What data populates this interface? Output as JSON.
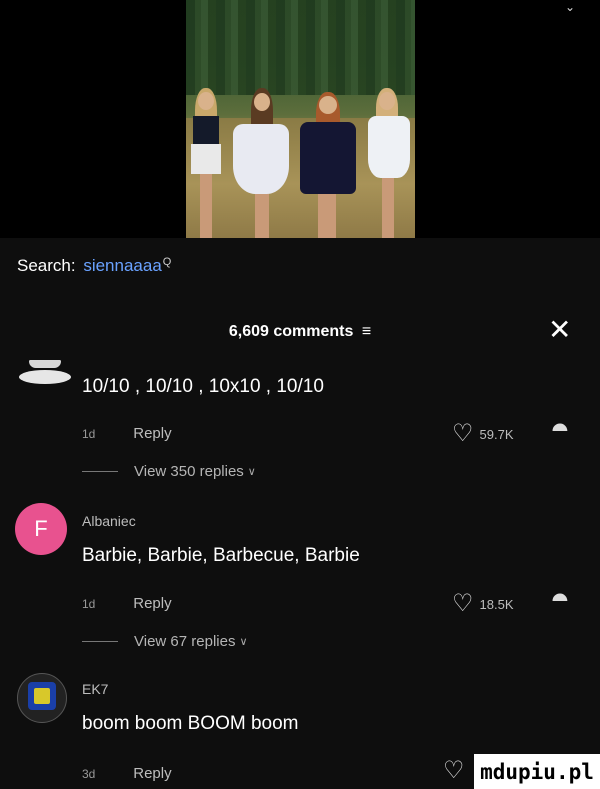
{
  "search": {
    "label": "Search:",
    "query": "siennaaaa"
  },
  "comments": {
    "count_label": "6,609 comments",
    "items": [
      {
        "username": "",
        "text": "10/10 , 10/10 , 10x10 , 10/10",
        "time": "1d",
        "reply": "Reply",
        "likes": "59.7K",
        "view_replies": "View 350 replies"
      },
      {
        "username": "Albaniec",
        "avatar_letter": "F",
        "text": "Barbie, Barbie, Barbecue, Barbie",
        "time": "1d",
        "reply": "Reply",
        "likes": "18.5K",
        "view_replies": "View 67 replies"
      },
      {
        "username": "EK7",
        "text": "boom boom BOOM boom",
        "time": "3d",
        "reply": "Reply"
      }
    ]
  },
  "watermark": "mdupiu.pl",
  "colors": {
    "background": "#0e0e0e",
    "link": "#6aa2ff",
    "avatar_f": "#e8528f"
  },
  "icons": [
    "search-icon",
    "filter-icon",
    "close-icon",
    "heart-icon",
    "dislike-icon",
    "chevron-down-icon"
  ]
}
